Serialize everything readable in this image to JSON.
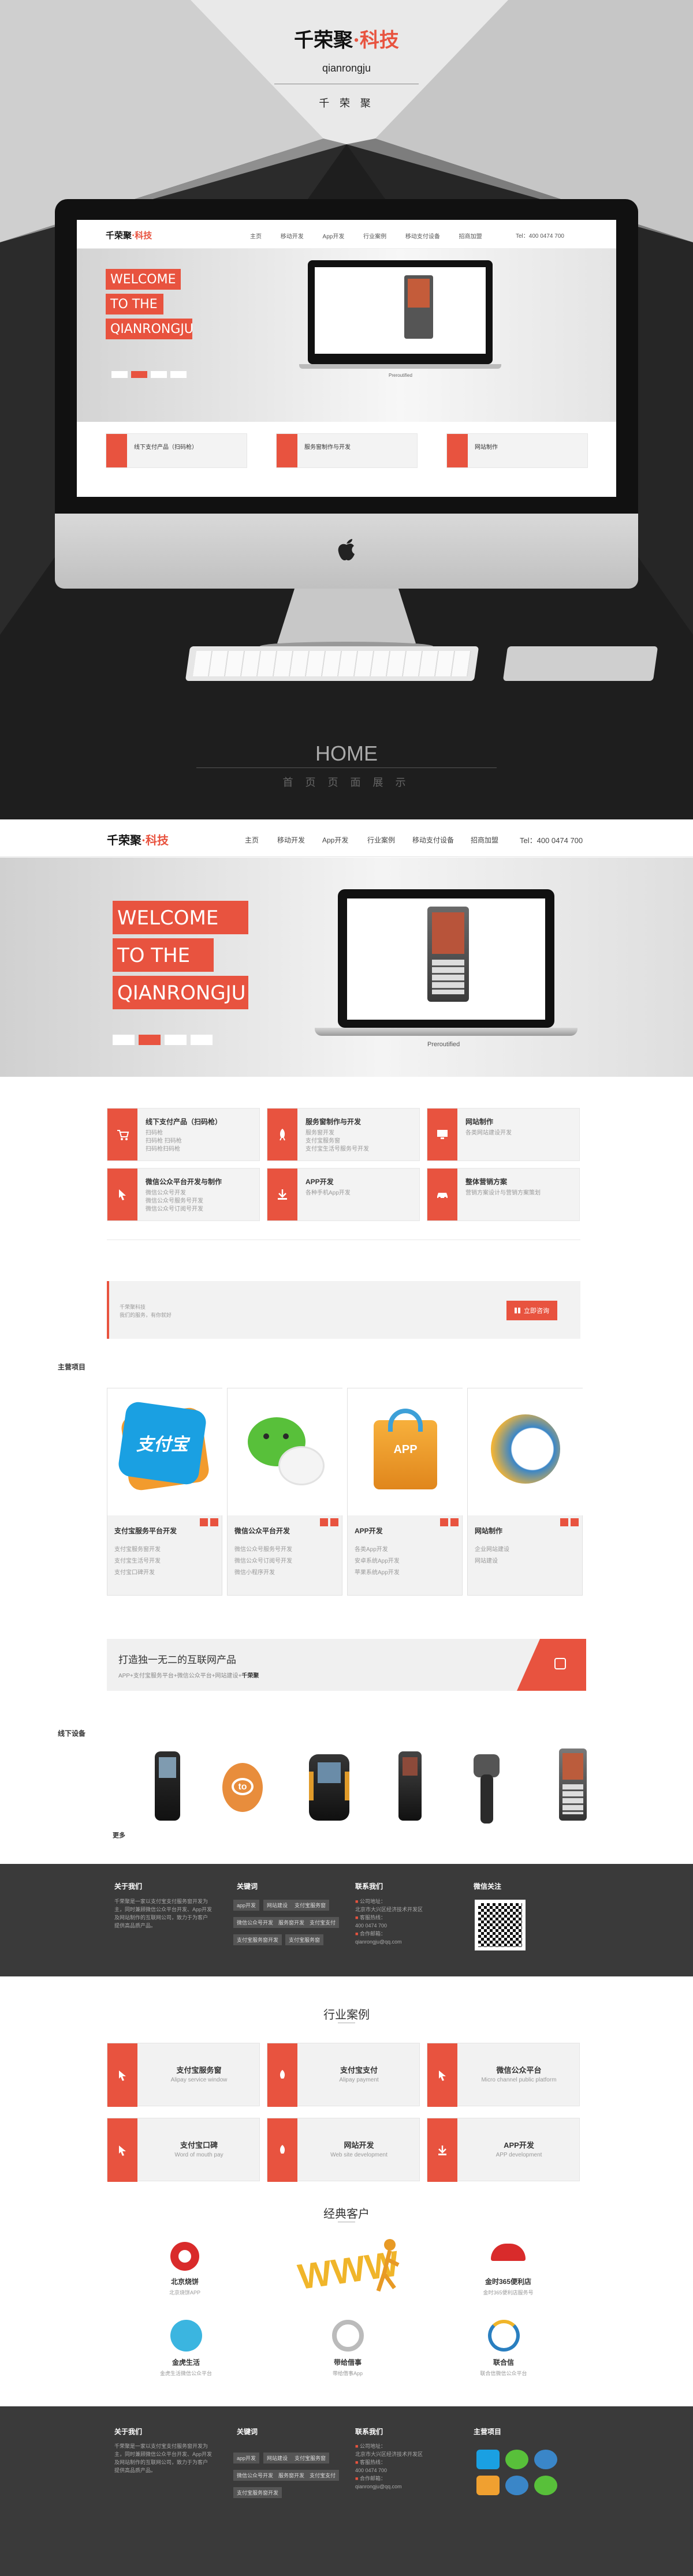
{
  "hero": {
    "brand": "千荣聚",
    "brand_accent": "·科技",
    "brand_latin": "qianrongju",
    "brand_sub": "千  荣  聚",
    "home": "HOME",
    "home_sub": "首  页  页  面  展  示",
    "colors": {
      "accent": "#e8533f",
      "dark": "#1e1e1e"
    }
  },
  "nav": {
    "logo": "千荣聚",
    "logo_accent": "·科技",
    "items": [
      "主页",
      "移动开发",
      "App开发",
      "行业案例",
      "移动支付设备",
      "招商加盟"
    ],
    "phone": "Tel：400 0474 700"
  },
  "banner": {
    "lines": [
      "WELCOME",
      "TO THE",
      "QIANRONGJU"
    ],
    "laptop_caption": "Preroutified"
  },
  "services": [
    {
      "title": "线下支付产品（扫码枪）",
      "lines": [
        "扫码枪",
        "扫码枪 扫码枪",
        "扫码枪扫码枪"
      ]
    },
    {
      "title": "服务窗制作与开发",
      "lines": [
        "服务窗开发",
        "支付宝服务窗",
        "支付宝生活号服务号开发"
      ]
    },
    {
      "title": "网站制作",
      "lines": [
        "各类网站建设开发"
      ]
    },
    {
      "title": "微信公众平台开发与制作",
      "lines": [
        "微信公众号开发",
        "微信公众号服务号开发",
        "微信公众号订阅号开发"
      ]
    },
    {
      "title": "APP开发",
      "lines": [
        "各种手机App开发"
      ]
    },
    {
      "title": "整体营销方案",
      "lines": [
        "营销方案设计与营销方案策划"
      ]
    }
  ],
  "notice": {
    "lines": [
      "千荣聚科技",
      "我们的服务，有你就好"
    ],
    "button": "立即咨询"
  },
  "main_projects": {
    "label": "主营项目",
    "items": [
      {
        "title": "支付宝服务平台开发",
        "lines": [
          "支付宝服务窗开发",
          "支付宝生活号开发",
          "支付宝口碑开发"
        ],
        "icon": "alipay-icon"
      },
      {
        "title": "微信公众平台开发",
        "lines": [
          "微信公众号服务号开发",
          "微信公众号订阅号开发",
          "微信小程序开发"
        ],
        "icon": "wechat-icon"
      },
      {
        "title": "APP开发",
        "lines": [
          "各类App开发",
          "安卓系统App开发",
          "苹果系统App开发"
        ],
        "icon": "app-store-icon"
      },
      {
        "title": "网站制作",
        "lines": [
          "企业网站建设",
          "网站建设"
        ],
        "icon": "globe-icon"
      }
    ]
  },
  "slogan": {
    "title": "打造独一无二的互联网产品",
    "sub": "APP+支付宝服务平台+微信公众平台+网站建设+",
    "sub_brand": "千荣聚"
  },
  "devices": {
    "label": "线下设备",
    "more": "更多"
  },
  "footer": {
    "about_title": "关于我们",
    "about_text": "千荣聚是一家以支付宝支付服务窗开发为主，同时兼顾微信公众平台开发、App开发及网站制作的互联网公司，致力于为客户提供高品质产品。",
    "keywords_title": "关键词",
    "keywords": [
      "app开发",
      "网站建设",
      "支付宝服务窗",
      "微信公众号开发",
      "服务窗开发",
      "支付宝支付",
      "支付宝服务窗开发",
      "支付宝服务窗"
    ],
    "contact_title": "联系我们",
    "contact": [
      "公司地址：",
      "北京市大兴区经济技术开发区",
      "客服热线：",
      "400 0474 700",
      "合作邮箱：",
      "qianrongju@qq.com"
    ],
    "qr_title": "微信关注",
    "projects_title": "主营项目"
  },
  "cases": {
    "title": "行业案例",
    "items": [
      {
        "title": "支付宝服务窗",
        "sub": "Alipay service window"
      },
      {
        "title": "支付宝支付",
        "sub": "Alipay payment"
      },
      {
        "title": "微信公众平台",
        "sub": "Micro channel public platform"
      },
      {
        "title": "支付宝口碑",
        "sub": "Word of mouth pay"
      },
      {
        "title": "网站开发",
        "sub": "Web site development"
      },
      {
        "title": "APP开发",
        "sub": "APP development"
      }
    ]
  },
  "classic": {
    "title": "经典客户",
    "items": [
      {
        "name": "北京烧饼",
        "sub": "北京烧饼APP"
      },
      {
        "name": "金时365便利店",
        "sub": "金时365便利店服务号"
      },
      {
        "name": "金虎生活",
        "sub": "金虎生活微信公众平台"
      },
      {
        "name": "带给借事",
        "sub": "带给借事App"
      },
      {
        "name": "联合信",
        "sub": "联合信微信公众平台"
      }
    ]
  }
}
